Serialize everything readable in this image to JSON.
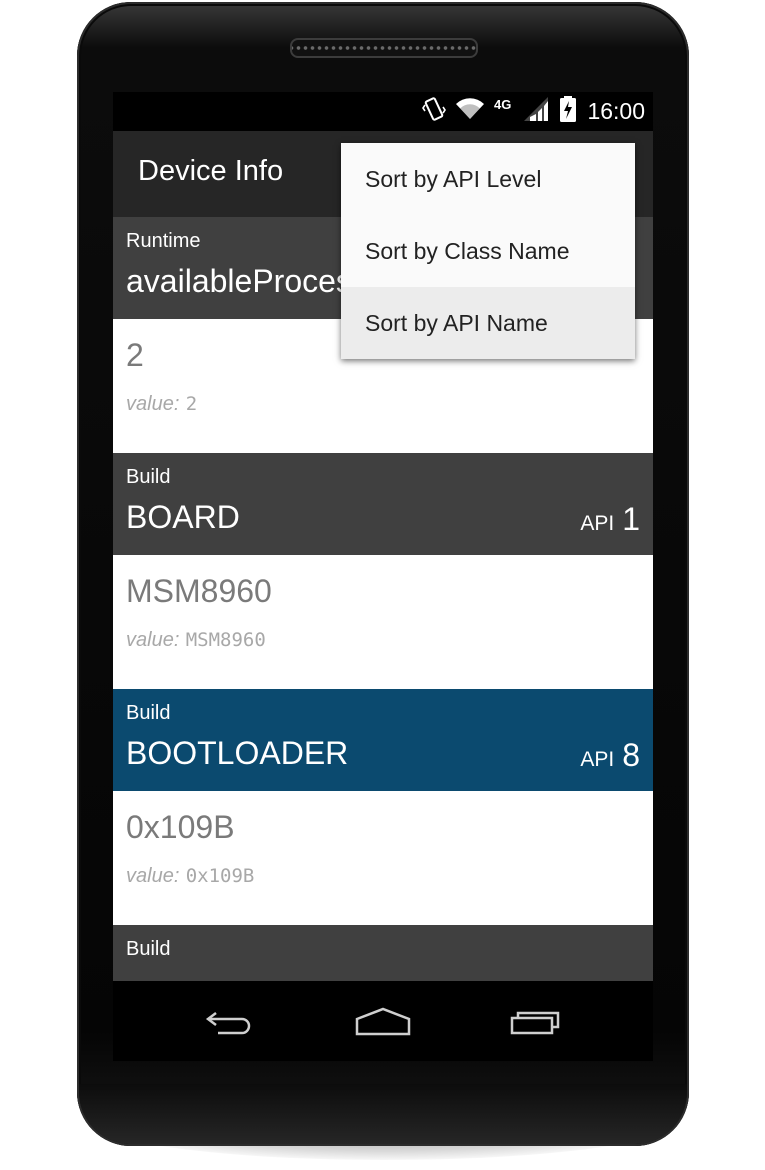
{
  "status_bar": {
    "time": "16:00",
    "network_label": "4G",
    "icons": [
      "vibrate-icon",
      "wifi-icon",
      "4g-lte-icon",
      "signal-icon",
      "battery-charging-icon"
    ]
  },
  "action_bar": {
    "title": "Device Info"
  },
  "menu": {
    "items": [
      {
        "label": "Sort by API Level"
      },
      {
        "label": "Sort by Class Name"
      },
      {
        "label": "Sort by API Name"
      }
    ]
  },
  "list": {
    "value_prefix": "value:",
    "api_label": "API",
    "items": [
      {
        "class": "Runtime",
        "name": "availableProcessors",
        "api": "",
        "value": "2",
        "raw": "2"
      },
      {
        "class": "Build",
        "name": "BOARD",
        "api": "1",
        "value": "MSM8960",
        "raw": "MSM8960"
      },
      {
        "class": "Build",
        "name": "BOOTLOADER",
        "api": "8",
        "value": "0x109B",
        "raw": "0x109B"
      },
      {
        "class": "Build"
      }
    ]
  },
  "colors": {
    "action_bar": "#262626",
    "header": "#404040",
    "header_selected": "#0b4a6f",
    "menu_background": "#fafafa"
  },
  "nav_icons": [
    "back-icon",
    "home-icon",
    "recent-apps-icon"
  ]
}
